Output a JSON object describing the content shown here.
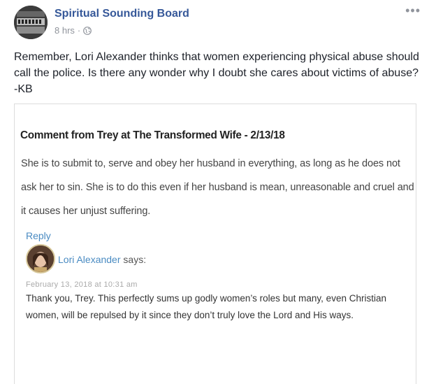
{
  "post": {
    "page_name": "Spiritual Sounding Board",
    "time": "8 hrs",
    "separator": "·",
    "privacy_icon": "globe-icon",
    "more_icon": "more-options-icon",
    "more_glyph": "•••",
    "caption": "Remember, Lori Alexander thinks that women experiencing physical abuse should call the police. Is there any wonder why I doubt she cares about victims of abuse? -KB"
  },
  "embed": {
    "title": "Comment from Trey at The Transformed Wife - 2/13/18",
    "quote": "She is to submit to, serve and obey her husband in everything, as long as he does not ask her to sin. She is to do this even if her husband is mean, unreasonable and cruel and it causes her unjust suffering.",
    "reply_label": "Reply",
    "author_name": "Lori Alexander",
    "says_label": "says:",
    "timestamp": "February 13, 2018 at 10:31 am",
    "reply_text": "Thank you, Trey. This perfectly sums up godly women’s roles but many, even Christian women, will be repulsed by it since they don’t truly love the Lord and His ways."
  },
  "colors": {
    "link": "#365899",
    "meta": "#90949c",
    "blog_link": "#4a8bc2"
  }
}
